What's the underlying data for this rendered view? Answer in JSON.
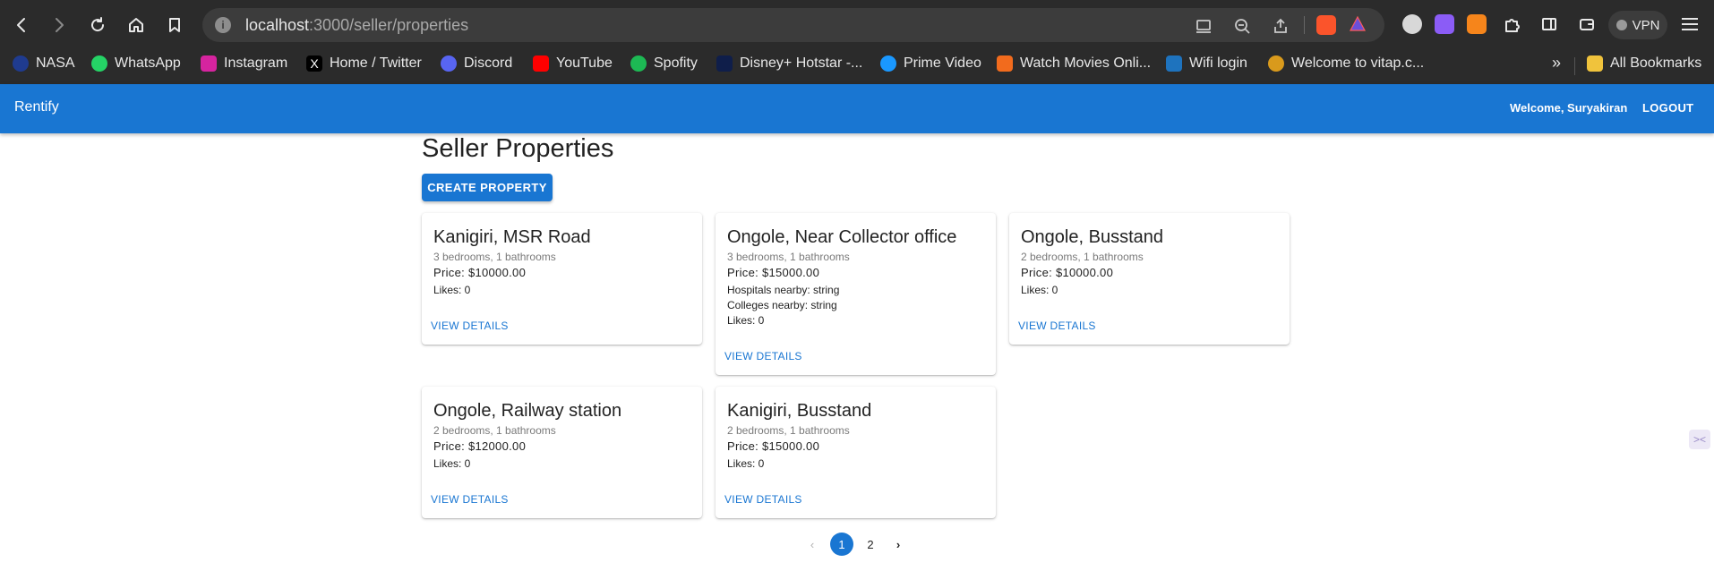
{
  "browser": {
    "url_host": "localhost",
    "url_path": ":3000/seller/properties",
    "vpn_label": "VPN",
    "bookmarks": [
      {
        "label": "NASA",
        "color": "#1f3b8f"
      },
      {
        "label": "WhatsApp",
        "color": "#25d366"
      },
      {
        "label": "Instagram",
        "color": "#d6249f"
      },
      {
        "label": "Home / Twitter",
        "color": "#000000"
      },
      {
        "label": "Discord",
        "color": "#5865f2"
      },
      {
        "label": "YouTube",
        "color": "#ff0000"
      },
      {
        "label": "Spofity",
        "color": "#1db954"
      },
      {
        "label": "Disney+ Hotstar -...",
        "color": "#0f1e4a"
      },
      {
        "label": "Prime Video",
        "color": "#1a98ff"
      },
      {
        "label": "Watch Movies Onli...",
        "color": "#f26b1d"
      },
      {
        "label": "Wifi login",
        "color": "#1e73be"
      },
      {
        "label": "Welcome to vitap.c...",
        "color": "#d99a1c"
      }
    ],
    "more_label": "»",
    "all_bookmarks": "All Bookmarks"
  },
  "appbar": {
    "brand": "Rentify",
    "welcome": "Welcome, Suryakiran",
    "logout": "LOGOUT",
    "color": "#1976d2"
  },
  "page": {
    "title": "Seller Properties",
    "create_button": "CREATE PROPERTY"
  },
  "properties": [
    {
      "title": "Kanigiri, MSR Road",
      "specs": "3 bedrooms, 1 bathrooms",
      "price": "Price: $10000.00",
      "likes": "Likes: 0",
      "details": "VIEW DETAILS"
    },
    {
      "title": "Ongole, Near Collector office",
      "specs": "3 bedrooms, 1 bathrooms",
      "price": "Price: $15000.00",
      "hospitals": "Hospitals nearby: string",
      "colleges": "Colleges nearby: string",
      "likes": "Likes: 0",
      "details": "VIEW DETAILS"
    },
    {
      "title": "Ongole, Busstand",
      "specs": "2 bedrooms, 1 bathrooms",
      "price": "Price: $10000.00",
      "likes": "Likes: 0",
      "details": "VIEW DETAILS"
    },
    {
      "title": "Ongole, Railway station",
      "specs": "2 bedrooms, 1 bathrooms",
      "price": "Price: $12000.00",
      "likes": "Likes: 0",
      "details": "VIEW DETAILS"
    },
    {
      "title": "Kanigiri, Busstand",
      "specs": "2 bedrooms, 1 bathrooms",
      "price": "Price: $15000.00",
      "likes": "Likes: 0",
      "details": "VIEW DETAILS"
    }
  ],
  "pagination": {
    "prev": "‹",
    "pages": [
      "1",
      "2"
    ],
    "current": "1",
    "next": "›"
  }
}
